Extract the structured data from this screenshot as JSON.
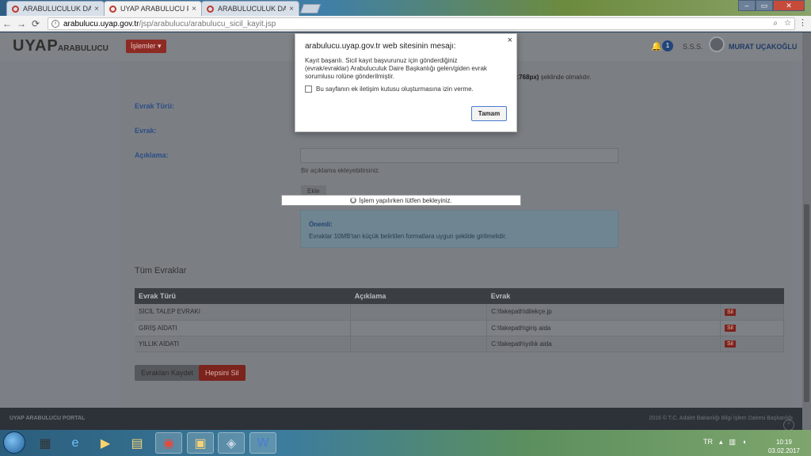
{
  "browser": {
    "tabs": [
      {
        "label": "ARABULUCULUK DAİRE",
        "close": "×"
      },
      {
        "label": "UYAP ARABULUCU PORT",
        "close": "×"
      },
      {
        "label": "ARABULUCULUK DAİRE",
        "close": "×"
      }
    ],
    "url_host": "arabulucu.uyap.gov.tr",
    "url_path": "/jsp/arabulucu/arabulucu_sicil_kayit.jsp",
    "nav": {
      "back": "←",
      "forward": "→",
      "reload": "⟳"
    }
  },
  "header": {
    "logo": "UYAP",
    "logo_sub": "ARABULUCU",
    "menu_label": "İşlemler ▾",
    "notif_count": "1",
    "sss": "S.S.S.",
    "user_name": "MURAT UÇAKOĞLU"
  },
  "form": {
    "evrak_turu_label": "Evrak Türü:",
    "evrak_label": "Evrak:",
    "aciklama_label": "Açıklama:",
    "resolution_bold": "k:768px)",
    "resolution_rest": " şeklinde olmalıdır.",
    "aciklama_hint": "Bir açıklama ekleyebilirsiniz.",
    "ekle_label": "Ekle",
    "important_title": "Önemli:",
    "important_msg": "Evraklar 10MB'tan küçük belirtilen formatlara uygun şekilde girilmelidir."
  },
  "documents": {
    "title": "Tüm Evraklar",
    "columns": [
      "Evrak Türü",
      "Açıklama",
      "Evrak",
      ""
    ],
    "rows": [
      {
        "type": "SİCİL TALEP EVRAKI",
        "desc": "",
        "file": "C:\\fakepath\\dilekçe.jp",
        "action": "Sil"
      },
      {
        "type": "GİRİŞ AİDATI",
        "desc": "",
        "file": "C:\\fakepath\\giriş aida",
        "action": "Sil"
      },
      {
        "type": "YILLIK AİDATI",
        "desc": "",
        "file": "C:\\fakepath\\yıllık aida",
        "action": "Sil"
      }
    ],
    "save_label": "Evrakları Kaydet",
    "delete_all_label": "Hepsini Sil"
  },
  "footer": {
    "left": "UYAP ARABULUCU PORTAL",
    "right": "2016 © T.C. Adalet Bakanlığı Bilgi İşlem Dairesi Başkanlığı"
  },
  "loading_text": "İşlem yapılırken lütfen bekleyiniz.",
  "dialog": {
    "title": "arabulucu.uyap.gov.tr web sitesinin mesajı:",
    "message": "Kayıt başarılı. Sicil kayıt başvurunuz için gönderdiğiniz (evrak/evraklar) Arabuluculuk Daire Başkanlığı gelen/giden evrak sorumlusu rolüne gönderilmiştir.",
    "checkbox_label": "Bu sayfanın ek iletişim kutusu oluşturmasına izin verme.",
    "ok_label": "Tamam",
    "close": "×"
  },
  "taskbar": {
    "tray_lang": "TR",
    "time": "10:19",
    "date": "03.02.2017"
  },
  "icons": {
    "start": "windows-start-icon",
    "apps": [
      "calculator-icon",
      "internet-explorer-icon",
      "media-player-icon",
      "file-explorer-icon",
      "chrome-icon",
      "folder-icon",
      "app-icon",
      "word-icon"
    ]
  },
  "colors": {
    "brand_blue": "#2c4f86",
    "danger": "#7b231d",
    "dialog_button_border": "#4a7bd0"
  }
}
